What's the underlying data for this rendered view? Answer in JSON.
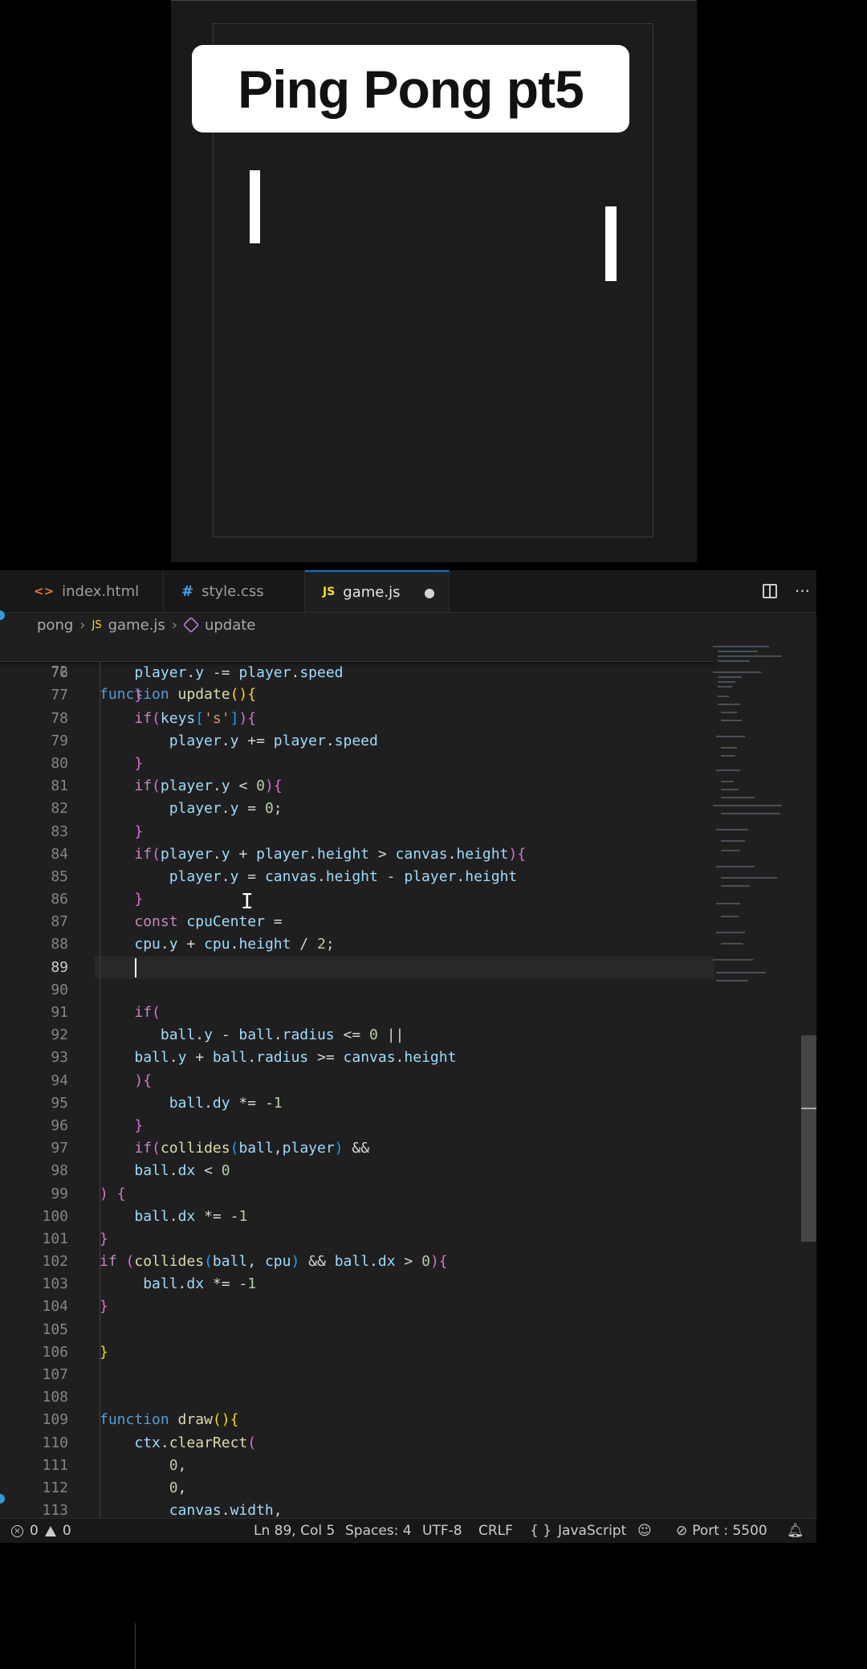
{
  "preview": {
    "title": "Ping Pong pt5"
  },
  "tabs": [
    {
      "label": "index.html",
      "icon": "<>",
      "icon_name": "html-file-icon"
    },
    {
      "label": "style.css",
      "icon": "#",
      "icon_name": "css-file-icon"
    },
    {
      "label": "game.js",
      "icon": "JS",
      "icon_name": "js-file-icon",
      "active": true,
      "unsaved": true
    }
  ],
  "breadcrumb": {
    "folder": "pong",
    "file_icon": "JS",
    "file": "game.js",
    "symbol": "update"
  },
  "code": {
    "sticky_line": {
      "num": "72",
      "text": "function update(){"
    },
    "lines": [
      {
        "num": "76"
      },
      {
        "num": "77"
      },
      {
        "num": "78"
      },
      {
        "num": "79"
      },
      {
        "num": "80"
      },
      {
        "num": "81"
      },
      {
        "num": "82"
      },
      {
        "num": "83"
      },
      {
        "num": "84"
      },
      {
        "num": "85"
      },
      {
        "num": "86"
      },
      {
        "num": "87"
      },
      {
        "num": "88"
      },
      {
        "num": "89"
      },
      {
        "num": "90"
      },
      {
        "num": "91"
      },
      {
        "num": "92"
      },
      {
        "num": "93"
      },
      {
        "num": "94"
      },
      {
        "num": "95"
      },
      {
        "num": "96"
      },
      {
        "num": "97"
      },
      {
        "num": "98"
      },
      {
        "num": "99"
      },
      {
        "num": "100"
      },
      {
        "num": "101"
      },
      {
        "num": "102"
      },
      {
        "num": "103"
      },
      {
        "num": "104"
      },
      {
        "num": "105"
      },
      {
        "num": "106"
      },
      {
        "num": "107"
      },
      {
        "num": "108"
      },
      {
        "num": "109"
      },
      {
        "num": "110"
      },
      {
        "num": "111"
      },
      {
        "num": "112"
      },
      {
        "num": "113"
      }
    ]
  },
  "status": {
    "errors": "0",
    "warnings": "0",
    "position": "Ln 89, Col 5",
    "spaces": "Spaces: 4",
    "encoding": "UTF-8",
    "eol": "CRLF",
    "language_braces": "{ }",
    "language": "JavaScript",
    "port": "Port : 5500"
  },
  "colors": {
    "editor_bg": "#1f1f1f",
    "accent": "#0078d4",
    "keyword": "#c586c0",
    "storage": "#569cd6",
    "function": "#dcdcaa",
    "variable": "#9cdcfe",
    "number": "#b5cea8",
    "string": "#ce9178"
  }
}
